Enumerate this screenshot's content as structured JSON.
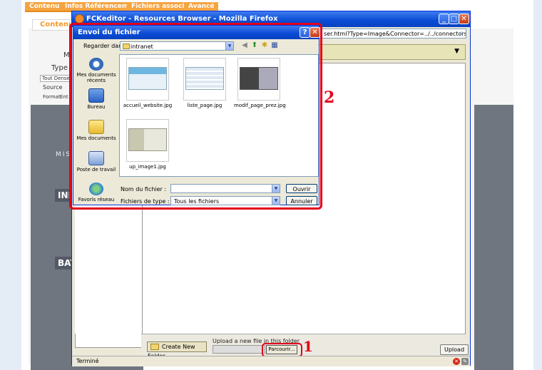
{
  "background": {
    "tabs": [
      "Contenu",
      "Infos Référencement",
      "Fichiers associés",
      "Avancé"
    ],
    "content_tab": "Contenu",
    "labels": {
      "mo": "Mo",
      "type": "Type d'a",
      "font": "Tout Dense",
      "source": "Source",
      "format": "Format",
      "entete": "Ent",
      "miss": "MISS",
      "ind": "IND",
      "bat": "BAT"
    }
  },
  "firefox": {
    "title": "FCKeditor - Resources Browser - Mozilla Firefox",
    "url": "ser.html?Type=Image&Connector=../../connectors/",
    "create_folder_label": "Create New Folder",
    "upload_label": "Upload a new file in this folder",
    "parcourir_label": "Parcourir...",
    "upload_button": "Upload",
    "status": "Terminé"
  },
  "dialog": {
    "title": "Envoi du fichier",
    "look_in_label": "Regarder dans :",
    "look_in_value": "intranet",
    "places": [
      {
        "label": "Mes documents récents",
        "icon": "recent-documents-icon"
      },
      {
        "label": "Bureau",
        "icon": "desktop-icon"
      },
      {
        "label": "Mes documents",
        "icon": "my-documents-icon"
      },
      {
        "label": "Poste de travail",
        "icon": "my-computer-icon"
      },
      {
        "label": "Favoris réseau",
        "icon": "network-places-icon"
      }
    ],
    "files": [
      {
        "name": "accueil_website.jpg"
      },
      {
        "name": "liste_page.jpg"
      },
      {
        "name": "modif_page_prez.jpg"
      },
      {
        "name": "up_image1.jpg"
      }
    ],
    "filename_label": "Nom du fichier :",
    "filename_value": "",
    "filetype_label": "Fichiers de type :",
    "filetype_value": "Tous les fichiers",
    "open_button": "Ouvrir",
    "cancel_button": "Annuler"
  },
  "annotations": {
    "marker_1": "1",
    "marker_2": "2"
  },
  "colors": {
    "highlight": "#e2001a",
    "xp_blue": "#0a4ad4",
    "cms_orange": "#f5a442"
  }
}
